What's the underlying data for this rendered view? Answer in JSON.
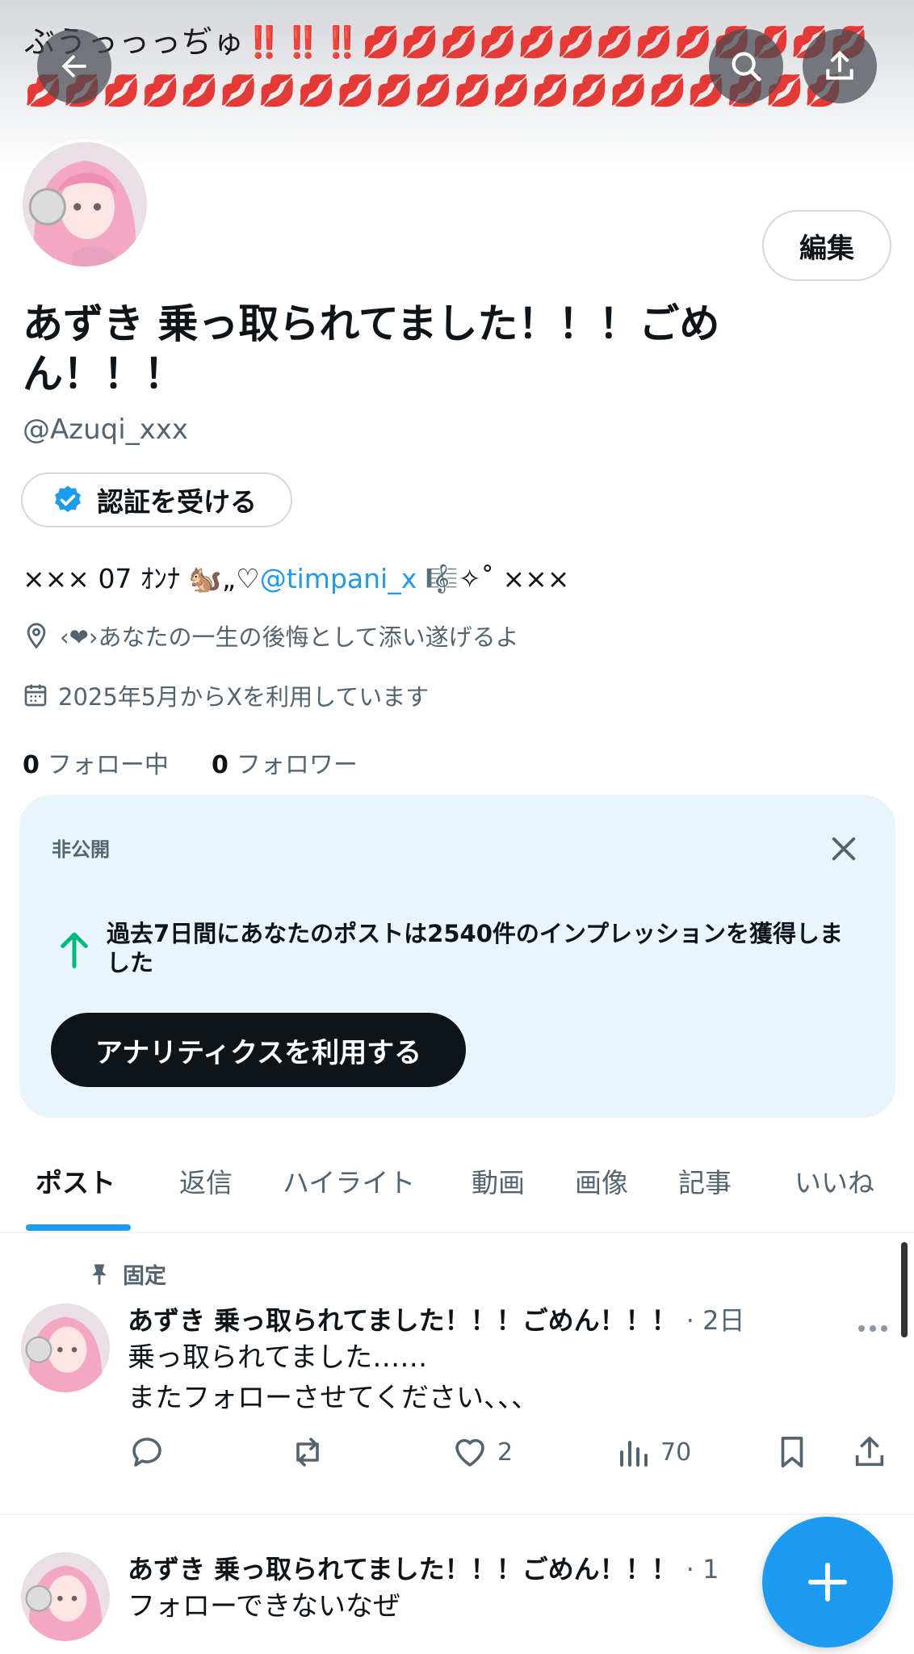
{
  "banner": {
    "text": "ぶうっっっぢゅ",
    "marks": "‼️‼️‼️",
    "lips": "💋💋💋💋💋💋💋💋💋💋💋💋💋💋💋💋💋💋💋💋💋💋💋💋💋💋💋💋💋💋💋💋💋💋"
  },
  "header": {
    "back_icon": "arrow-left-icon",
    "search_icon": "search-icon",
    "share_icon": "share-icon"
  },
  "profile": {
    "display_name": "あずき 乗っ取られてました！！！ごめん！！！",
    "handle": "@Azuqi_xxx",
    "edit_label": "編集",
    "verify_label": "認証を受ける",
    "bio_prefix": "××× 07 ｵﾝﾅ 🐿️„♡",
    "bio_link": "@timpani_x",
    "bio_suffix": " 🎼✧˚ ×××",
    "location": "‹❤︎›あなたの一生の後悔として添い遂げるよ",
    "joined": "2025年5月からXを利用しています",
    "following_count": "0",
    "following_label": "フォロー中",
    "followers_count": "0",
    "followers_label": "フォロワー"
  },
  "card": {
    "private_label": "非公開",
    "message": "過去7日間にあなたのポストは2540件のインプレッションを獲得しました",
    "button_label": "アナリティクスを利用する"
  },
  "tabs": [
    "ポスト",
    "返信",
    "ハイライト",
    "動画",
    "画像",
    "記事",
    "いいね"
  ],
  "posts": [
    {
      "pinned_label": "固定",
      "author": "あずき 乗っ取られてました！！！ごめん！！！",
      "time": "· 2日",
      "line1": "乗っ取られてました……",
      "line2": "またフォローさせてください、、、",
      "likes": "2",
      "views": "70"
    },
    {
      "author": "あずき 乗っ取られてました！！！ごめん！！！",
      "time": "· 1",
      "line1": "フォローできないなぜ"
    }
  ],
  "colors": {
    "accent": "#1d9bf0",
    "text": "#0f1419",
    "muted": "#536471",
    "card_bg": "#e8f5fd"
  }
}
